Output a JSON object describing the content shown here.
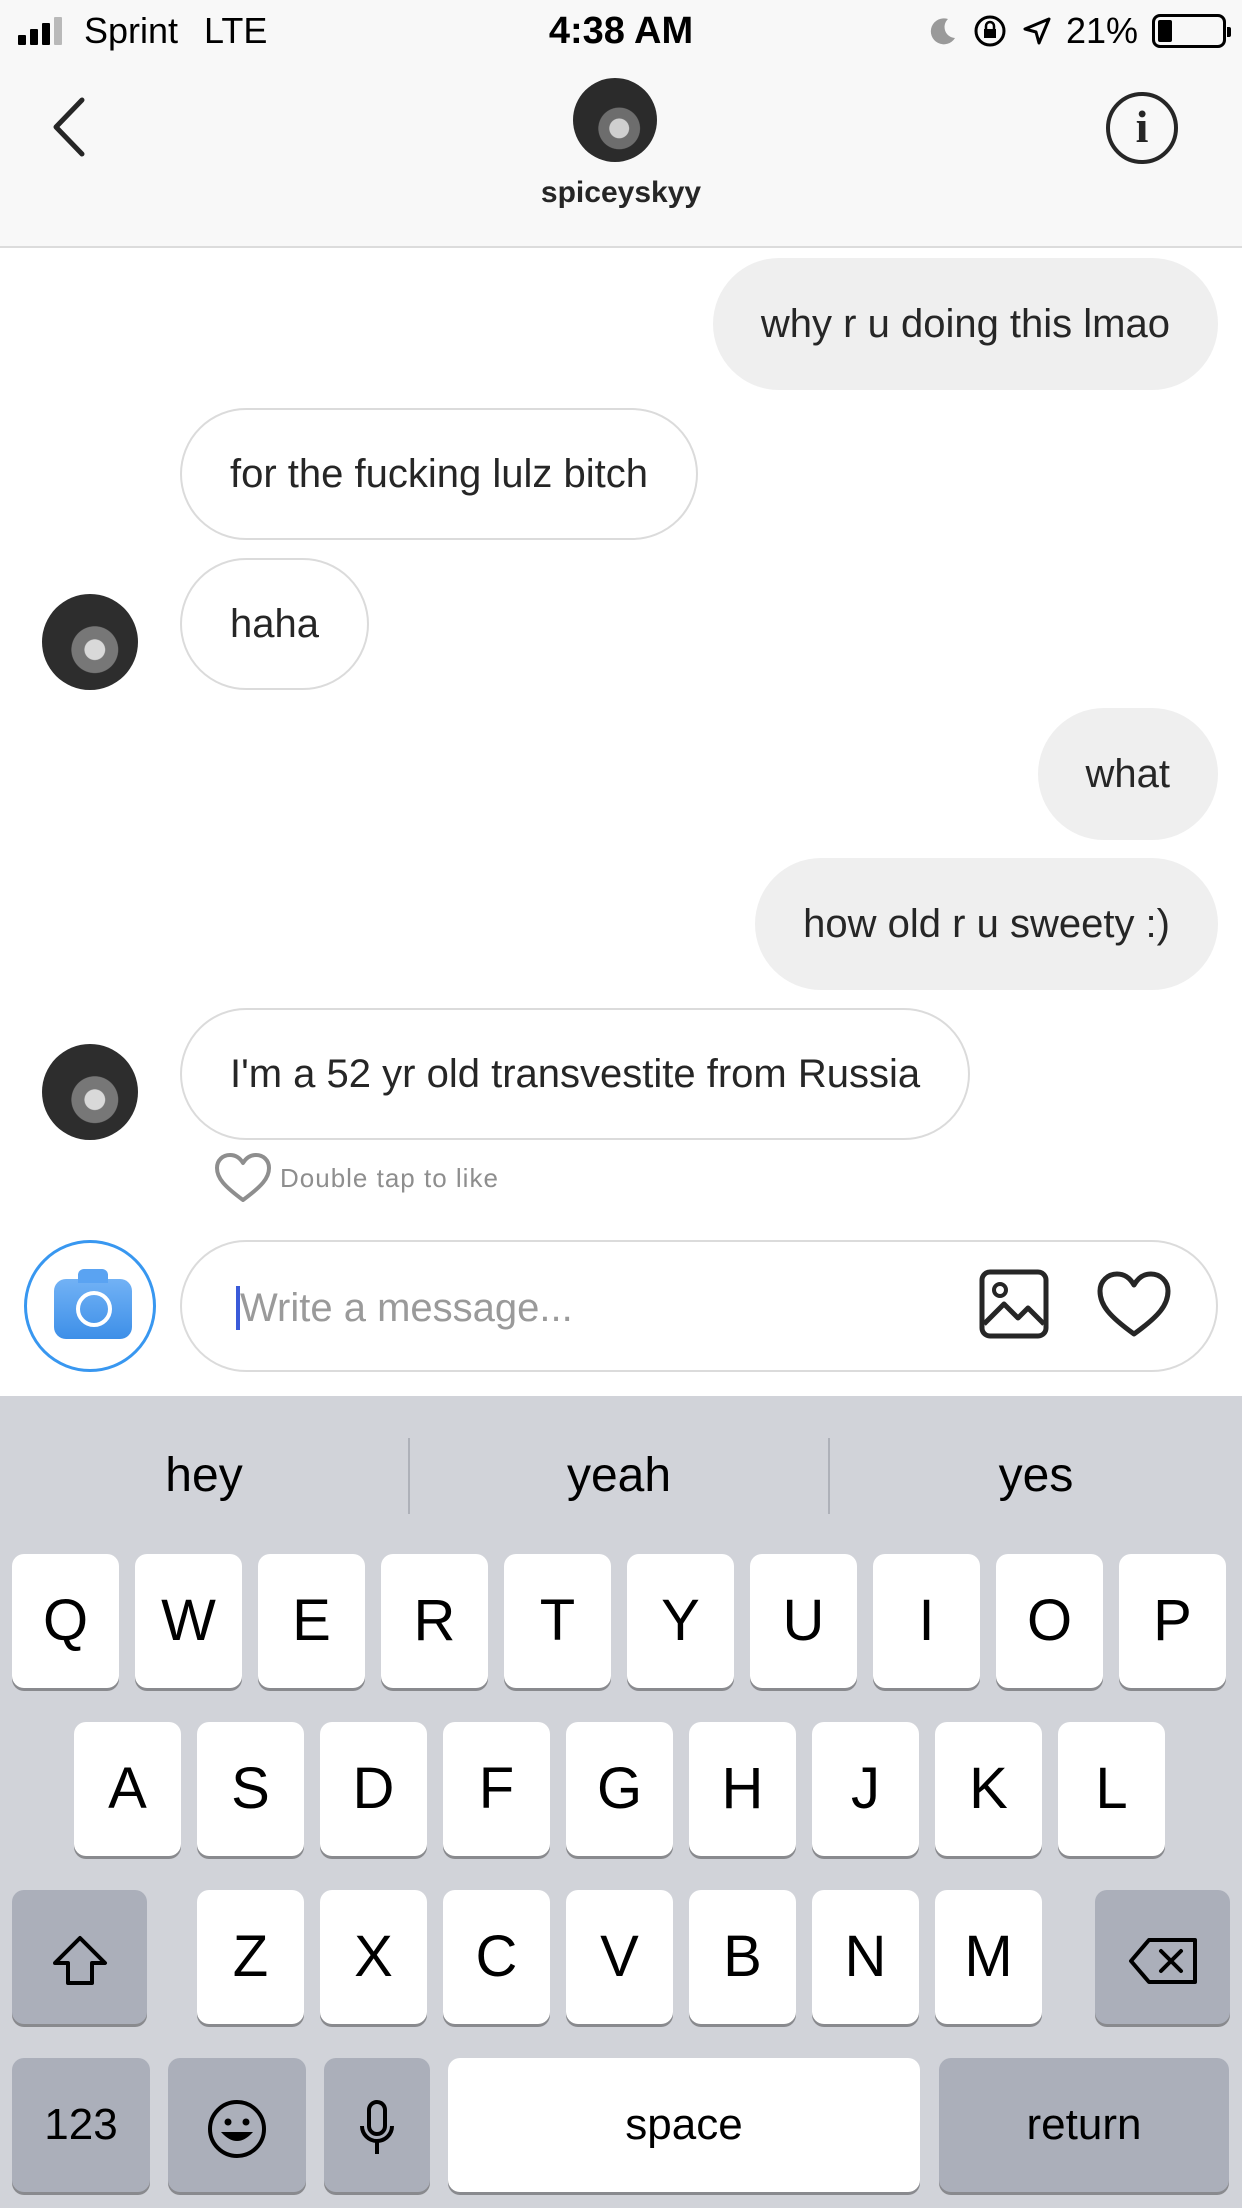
{
  "status_bar": {
    "carrier": "Sprint",
    "network": "LTE",
    "time": "4:38 AM",
    "battery": "21%",
    "battery_level": 0.21,
    "icons": [
      "signal-icon",
      "moon-icon",
      "rotation-lock-icon",
      "location-arrow-icon",
      "battery-icon"
    ]
  },
  "header": {
    "username": "spiceyskyy",
    "icons": [
      "back-chevron-icon",
      "info-icon"
    ]
  },
  "messages": [
    {
      "direction": "sent",
      "text": "why r u doing this lmao"
    },
    {
      "direction": "received",
      "text": "for the fucking lulz bitch"
    },
    {
      "direction": "received",
      "text": "haha"
    },
    {
      "direction": "sent",
      "text": "what"
    },
    {
      "direction": "sent",
      "text": "how old r u sweety :)"
    },
    {
      "direction": "received",
      "text": "I'm a 52 yr old transvestite from Russia"
    }
  ],
  "like_hint": "Double tap to like",
  "composer": {
    "placeholder": "Write a message...",
    "value": "",
    "icons": [
      "camera-icon",
      "gallery-icon",
      "heart-icon"
    ]
  },
  "keyboard": {
    "suggestions": [
      "hey",
      "yeah",
      "yes"
    ],
    "row1": [
      "Q",
      "W",
      "E",
      "R",
      "T",
      "Y",
      "U",
      "I",
      "O",
      "P"
    ],
    "row2": [
      "A",
      "S",
      "D",
      "F",
      "G",
      "H",
      "J",
      "K",
      "L"
    ],
    "row3": [
      "Z",
      "X",
      "C",
      "V",
      "B",
      "N",
      "M"
    ],
    "numbers_label": "123",
    "space_label": "space",
    "return_label": "return",
    "icons": [
      "shift-icon",
      "backspace-icon",
      "emoji-icon",
      "microphone-icon"
    ]
  },
  "colors": {
    "accent": "#3897f0",
    "sent_bubble": "#efefef",
    "keyboard_bg": "#d1d3d9",
    "cursor": "#3a5bd9"
  }
}
